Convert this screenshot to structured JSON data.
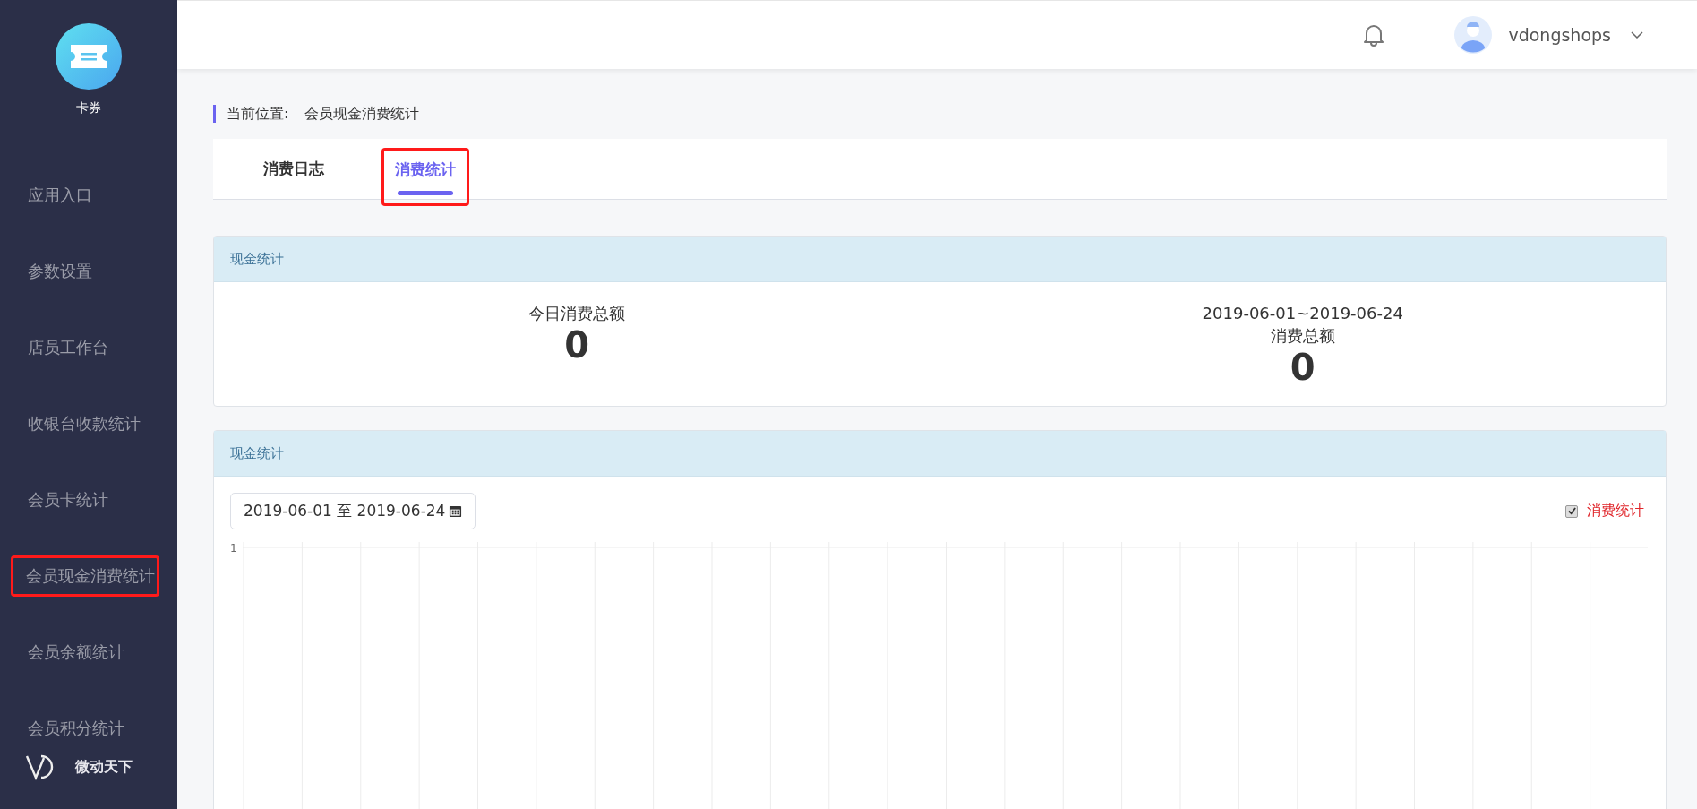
{
  "sidebar": {
    "app": {
      "label": "卡券"
    },
    "items": [
      {
        "label": "应用入口",
        "selected": false
      },
      {
        "label": "参数设置",
        "selected": false
      },
      {
        "label": "店员工作台",
        "selected": false
      },
      {
        "label": "收银台收款统计",
        "selected": false
      },
      {
        "label": "会员卡统计",
        "selected": false
      },
      {
        "label": "会员现金消费统计",
        "selected": true
      },
      {
        "label": "会员余额统计",
        "selected": false
      },
      {
        "label": "会员积分统计",
        "selected": false
      }
    ],
    "footer": {
      "brand": "微动天下"
    }
  },
  "header": {
    "username": "vdongshops"
  },
  "breadcrumb": {
    "label": "当前位置:",
    "current": "会员现金消费统计"
  },
  "tabs": [
    {
      "label": "消费日志",
      "selected": false
    },
    {
      "label": "消费统计",
      "selected": true
    }
  ],
  "summary_card": {
    "title": "现金统计",
    "stats": [
      {
        "caption": "今日消费总额",
        "value": "0"
      },
      {
        "range": "2019-06-01~2019-06-24",
        "caption": "消费总额",
        "value": "0"
      }
    ]
  },
  "chart_card": {
    "title": "现金统计",
    "date_range": "2019-06-01 至 2019-06-24",
    "legend": {
      "label": "消费统计",
      "checked": true
    },
    "y_tick": "1"
  }
}
